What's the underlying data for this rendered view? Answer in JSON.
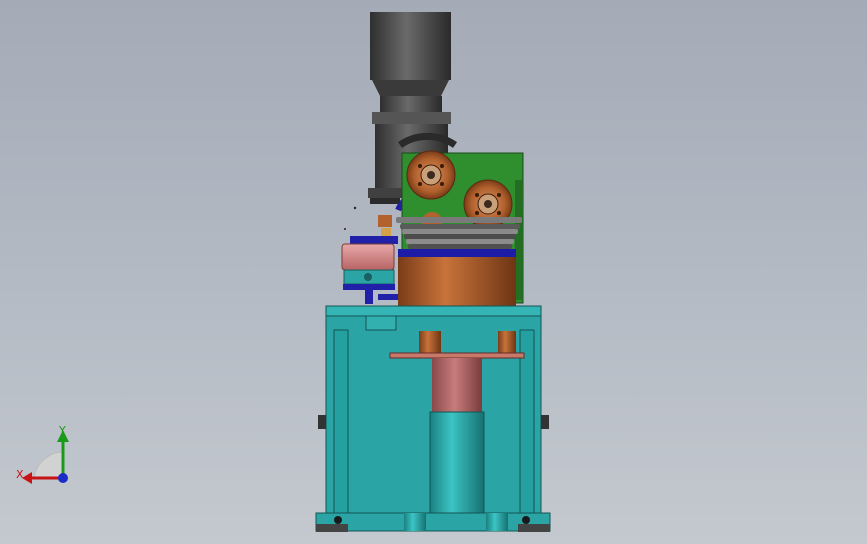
{
  "viewport": {
    "background_top": "#a4abb7",
    "background_bottom": "#c4c9cf"
  },
  "model": {
    "parts": [
      "motor",
      "gear-housing",
      "green-gearbox",
      "v-belt-pulleys",
      "copper-drum",
      "pink-pump",
      "teal-frame",
      "red-spindle",
      "teal-cylinder"
    ],
    "colors": {
      "motor": "#4b4b4b",
      "gearbox": "#2f8f2f",
      "drum": "#b3622e",
      "blue_band": "#1c1ca6",
      "frame": "#2aa4a4",
      "spindle": "#b86a6a",
      "pump": "#d89090"
    }
  },
  "triad": {
    "y_label": "Y",
    "x_label": "X",
    "y_color": "#1a9a1a",
    "x_color": "#c81414",
    "z_color": "#1c2cc8"
  }
}
